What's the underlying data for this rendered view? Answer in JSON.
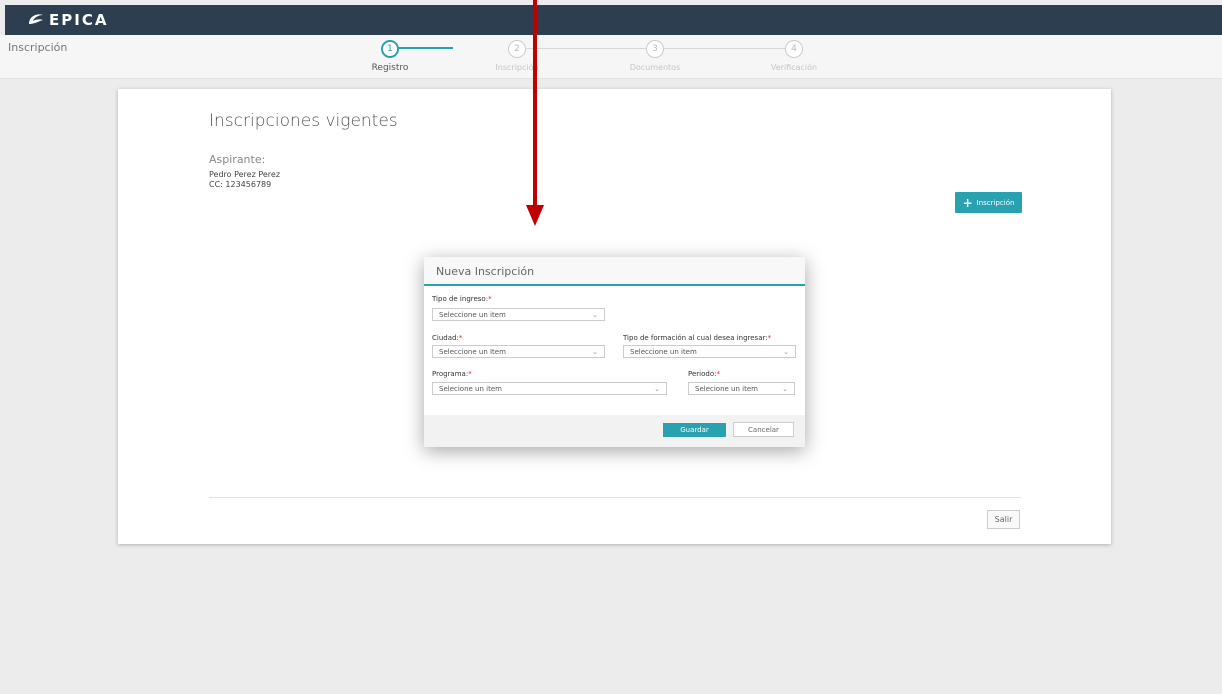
{
  "app": {
    "logo_text": "EPICA",
    "page_label": "Inscripción"
  },
  "steps": [
    {
      "number": "1",
      "label": "Registro",
      "active": true
    },
    {
      "number": "2",
      "label": "Inscripción",
      "active": false
    },
    {
      "number": "3",
      "label": "Documentos",
      "active": false
    },
    {
      "number": "4",
      "label": "Verificación",
      "active": false
    }
  ],
  "card": {
    "title": "Inscripciones vigentes",
    "aspirante_label": "Aspirante:",
    "aspirante_name": "Pedro Perez Perez",
    "aspirante_doc": "CC: 123456789",
    "add_button": "Inscripción",
    "exit_button": "Salir"
  },
  "modal": {
    "title": "Nueva Inscripción",
    "fields": {
      "tipo_ingreso": {
        "label": "Tipo de ingreso:",
        "value": "Seleccione un item"
      },
      "ciudad": {
        "label": "Ciudad:",
        "value": "Seleccione un Item"
      },
      "tipo_formacion": {
        "label": "Tipo de formación al cual desea ingresar:",
        "value": "Seleccione un item"
      },
      "programa": {
        "label": "Programa:",
        "value": "Selecione un item"
      },
      "periodo": {
        "label": "Periodo:",
        "value": "Selecione un item"
      }
    },
    "required_marker": "*",
    "save_button": "Guardar",
    "cancel_button": "Cancelar"
  },
  "colors": {
    "accent": "#2aa1b1",
    "topbar": "#2d3e50",
    "annotation_arrow": "#c00000"
  }
}
